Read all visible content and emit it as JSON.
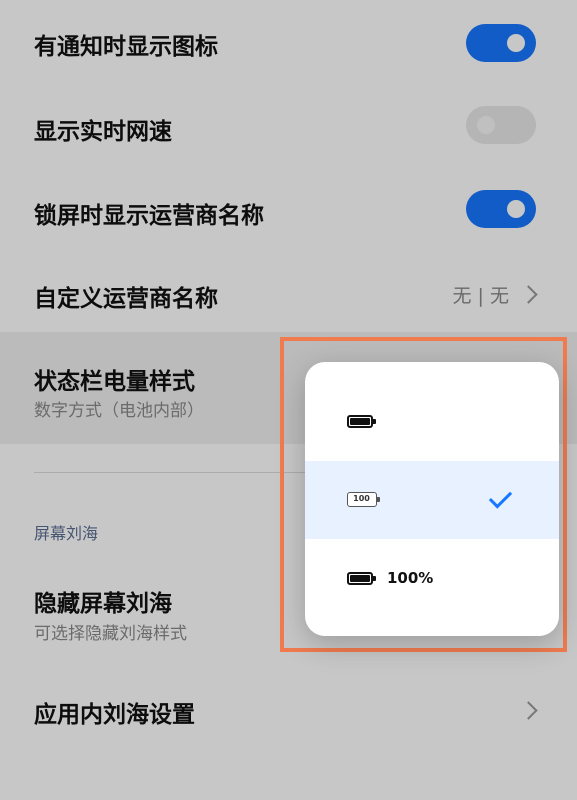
{
  "settings": {
    "show_icons_on_notification": {
      "label": "有通知时显示图标",
      "enabled": true
    },
    "show_realtime_speed": {
      "label": "显示实时网速",
      "enabled": false
    },
    "show_carrier_on_lock": {
      "label": "锁屏时显示运营商名称",
      "enabled": true
    },
    "custom_carrier": {
      "label": "自定义运营商名称",
      "value": "无 | 无"
    },
    "battery_style": {
      "label": "状态栏电量样式",
      "sub": "数字方式（电池内部）"
    },
    "notch_section": {
      "label": "屏幕刘海"
    },
    "hide_notch": {
      "label": "隐藏屏幕刘海",
      "sub": "可选择隐藏刘海样式"
    },
    "app_notch": {
      "label": "应用内刘海设置"
    }
  },
  "battery_popup": {
    "options": [
      {
        "icon": "battery-icon-plain",
        "text": "",
        "selected": false
      },
      {
        "icon": "battery-icon-number-inside",
        "badge": "100",
        "selected": true
      },
      {
        "icon": "battery-icon-with-percent",
        "text": "100%",
        "selected": false
      }
    ]
  },
  "colors": {
    "accent": "#1677ff",
    "highlight_frame": "#f07b4f"
  }
}
